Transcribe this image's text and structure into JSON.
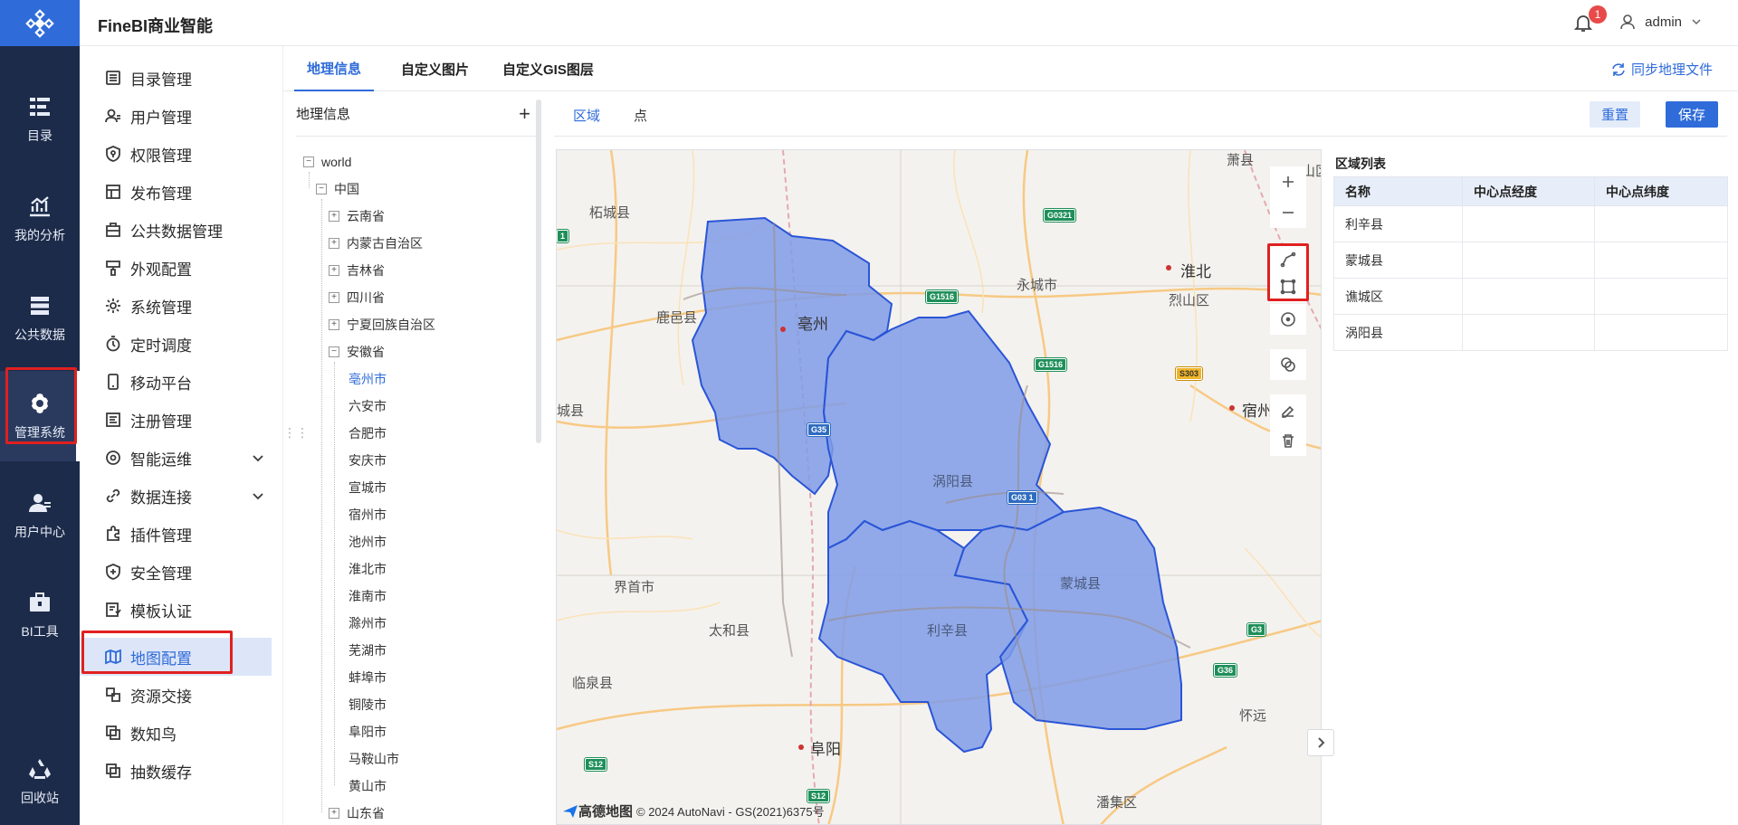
{
  "app": {
    "title": "FineBI商业智能"
  },
  "header": {
    "notification_count": "1",
    "user": "admin"
  },
  "rail": {
    "items": [
      {
        "label": "目录",
        "icon": "catalog-icon"
      },
      {
        "label": "我的分析",
        "icon": "chart-icon"
      },
      {
        "label": "公共数据",
        "icon": "database-icon"
      },
      {
        "label": "管理系统",
        "icon": "gear-icon",
        "active": true
      },
      {
        "label": "用户中心",
        "icon": "user-center-icon"
      },
      {
        "label": "BI工具",
        "icon": "toolbox-icon"
      },
      {
        "label": "回收站",
        "icon": "recycle-icon"
      }
    ]
  },
  "sidenav": {
    "items": [
      {
        "label": "目录管理"
      },
      {
        "label": "用户管理"
      },
      {
        "label": "权限管理"
      },
      {
        "label": "发布管理"
      },
      {
        "label": "公共数据管理"
      },
      {
        "label": "外观配置"
      },
      {
        "label": "系统管理"
      },
      {
        "label": "定时调度"
      },
      {
        "label": "移动平台"
      },
      {
        "label": "注册管理"
      },
      {
        "label": "智能运维"
      },
      {
        "label": "数据连接"
      },
      {
        "label": "插件管理"
      },
      {
        "label": "安全管理"
      },
      {
        "label": "模板认证"
      },
      {
        "label": "地图配置"
      },
      {
        "label": "资源交接"
      },
      {
        "label": "数知鸟"
      },
      {
        "label": "抽数缓存"
      }
    ]
  },
  "tabs": {
    "geo_info": "地理信息",
    "custom_image": "自定义图片",
    "custom_gis": "自定义GIS图层",
    "sync": "同步地理文件"
  },
  "geo_tree": {
    "header": "地理信息",
    "root": "world",
    "country": "中国",
    "provinces_before": [
      "云南省",
      "内蒙古自治区",
      "吉林省",
      "四川省",
      "宁夏回族自治区"
    ],
    "expanded_province": "安徽省",
    "cities": [
      "亳州市",
      "六安市",
      "合肥市",
      "安庆市",
      "宣城市",
      "宿州市",
      "池州市",
      "淮北市",
      "淮南市",
      "滁州市",
      "芜湖市",
      "蚌埠市",
      "铜陵市",
      "阜阳市",
      "马鞍山市",
      "黄山市"
    ],
    "province_after": "山东省"
  },
  "sub_tabs": {
    "region": "区域",
    "point": "点",
    "reset": "重置",
    "save": "保存"
  },
  "map": {
    "labels": {
      "zhecheng": "柘城县",
      "luyi": "鹿邑县",
      "bozhou": "亳州",
      "yongcheng": "永城市",
      "huaibei": "淮北",
      "lieshan": "烈山区",
      "suzhou": "宿州",
      "cheng": "城县",
      "woyang": "涡阳县",
      "jieshou": "界首市",
      "taihe": "太和县",
      "lixin": "利辛县",
      "mengcheng": "蒙城县",
      "linquan": "临泉县",
      "fuyang": "阜阳",
      "panji": "潘集区",
      "huai": "怀远",
      "xiao": "萧县",
      "shan": "山区"
    },
    "shields": {
      "g0321": "G0321",
      "g1516a": "G1516",
      "g1516b": "G1516",
      "s303": "S303",
      "g35": "G35",
      "g0311": "G03 1",
      "g3": "G3",
      "g36": "G36",
      "s12a": "S12",
      "s12b": "S12",
      "g1": "1"
    },
    "attribution_logo": "高德地图",
    "attribution": "© 2024 AutoNavi - GS(2021)6375号",
    "region_fill": "#7f9ce8",
    "region_stroke": "#2a55d6"
  },
  "region_list": {
    "caption": "区域列表",
    "columns": [
      "名称",
      "中心点经度",
      "中心点纬度"
    ],
    "rows": [
      [
        "利辛县",
        "",
        ""
      ],
      [
        "蒙城县",
        "",
        ""
      ],
      [
        "谯城区",
        "",
        ""
      ],
      [
        "涡阳县",
        "",
        ""
      ]
    ]
  }
}
